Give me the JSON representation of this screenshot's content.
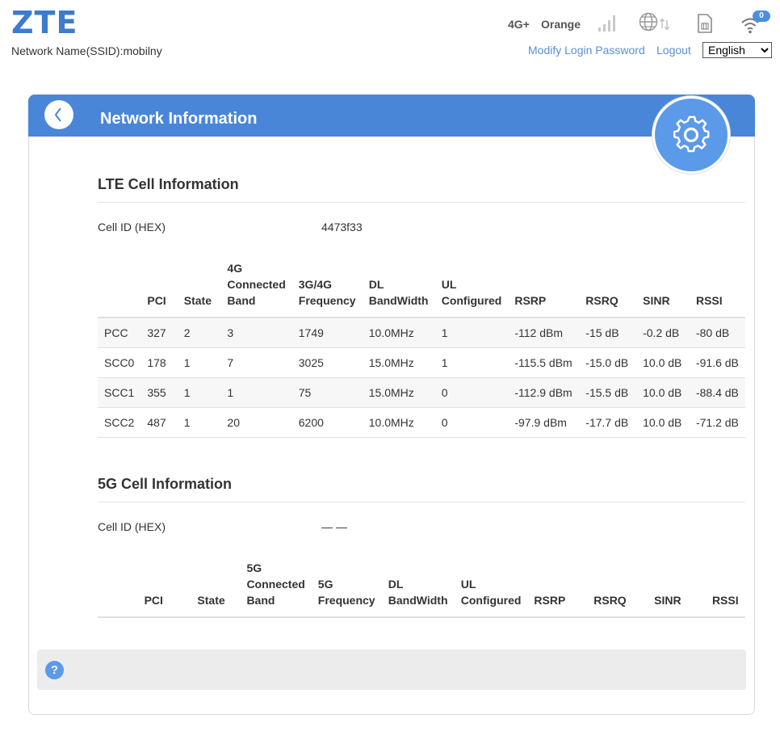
{
  "header": {
    "logo_text": "ZTE",
    "ssid_label": "Network Name(SSID):mobilny",
    "network_type": "4G+",
    "carrier": "Orange",
    "wifi_clients": "0",
    "modify_password_link": "Modify Login Password",
    "logout_link": "Logout",
    "language": {
      "selected": "English"
    },
    "icons": [
      "signal-icon",
      "globe-icon",
      "sim-card-icon",
      "wifi-icon"
    ]
  },
  "panel": {
    "title": "Network Information",
    "back_icon": "chevron-left-icon",
    "gear_icon": "gear-icon"
  },
  "lte": {
    "title": "LTE Cell Information",
    "cell_id_label": "Cell ID (HEX)",
    "cell_id_value": "4473f33",
    "headers": {
      "pci": "PCI",
      "state": "State",
      "band_l1": "4G",
      "band_l2": "Connected",
      "band_l3": "Band",
      "freq_l1": "3G/4G",
      "freq_l2": "Frequency",
      "dl_l1": "DL",
      "dl_l2": "BandWidth",
      "ul_l1": "UL",
      "ul_l2": "Configured",
      "rsrp": "RSRP",
      "rsrq": "RSRQ",
      "sinr": "SINR",
      "rssi": "RSSI"
    },
    "rows": [
      {
        "name": "PCC",
        "pci": "327",
        "state": "2",
        "band": "3",
        "freq": "1749",
        "dl": "10.0MHz",
        "ul": "1",
        "rsrp": "-112 dBm",
        "rsrq": "-15 dB",
        "sinr": "-0.2 dB",
        "rssi": "-80 dB"
      },
      {
        "name": "SCC0",
        "pci": "178",
        "state": "1",
        "band": "7",
        "freq": "3025",
        "dl": "15.0MHz",
        "ul": "1",
        "rsrp": "-115.5 dBm",
        "rsrq": "-15.0 dB",
        "sinr": "10.0 dB",
        "rssi": "-91.6 dB"
      },
      {
        "name": "SCC1",
        "pci": "355",
        "state": "1",
        "band": "1",
        "freq": "75",
        "dl": "15.0MHz",
        "ul": "0",
        "rsrp": "-112.9 dBm",
        "rsrq": "-15.5 dB",
        "sinr": "10.0 dB",
        "rssi": "-88.4 dB"
      },
      {
        "name": "SCC2",
        "pci": "487",
        "state": "1",
        "band": "20",
        "freq": "6200",
        "dl": "10.0MHz",
        "ul": "0",
        "rsrp": "-97.9 dBm",
        "rsrq": "-17.7 dB",
        "sinr": "10.0 dB",
        "rssi": "-71.2 dB"
      }
    ]
  },
  "nr": {
    "title": "5G Cell Information",
    "cell_id_label": "Cell ID (HEX)",
    "cell_id_value": "— —",
    "headers": {
      "pci": "PCI",
      "state": "State",
      "band_l1": "5G",
      "band_l2": "Connected",
      "band_l3": "Band",
      "freq_l1": "5G",
      "freq_l2": "Frequency",
      "dl_l1": "DL",
      "dl_l2": "BandWidth",
      "ul_l1": "UL",
      "ul_l2": "Configured",
      "rsrp": "RSRP",
      "rsrq": "RSRQ",
      "sinr": "SINR",
      "rssi": "RSSI"
    }
  },
  "help": {
    "icon_text": "?"
  },
  "colors": {
    "accent": "#4a86d8",
    "link": "#5a8fd6",
    "logo": "#3d7cc9"
  }
}
